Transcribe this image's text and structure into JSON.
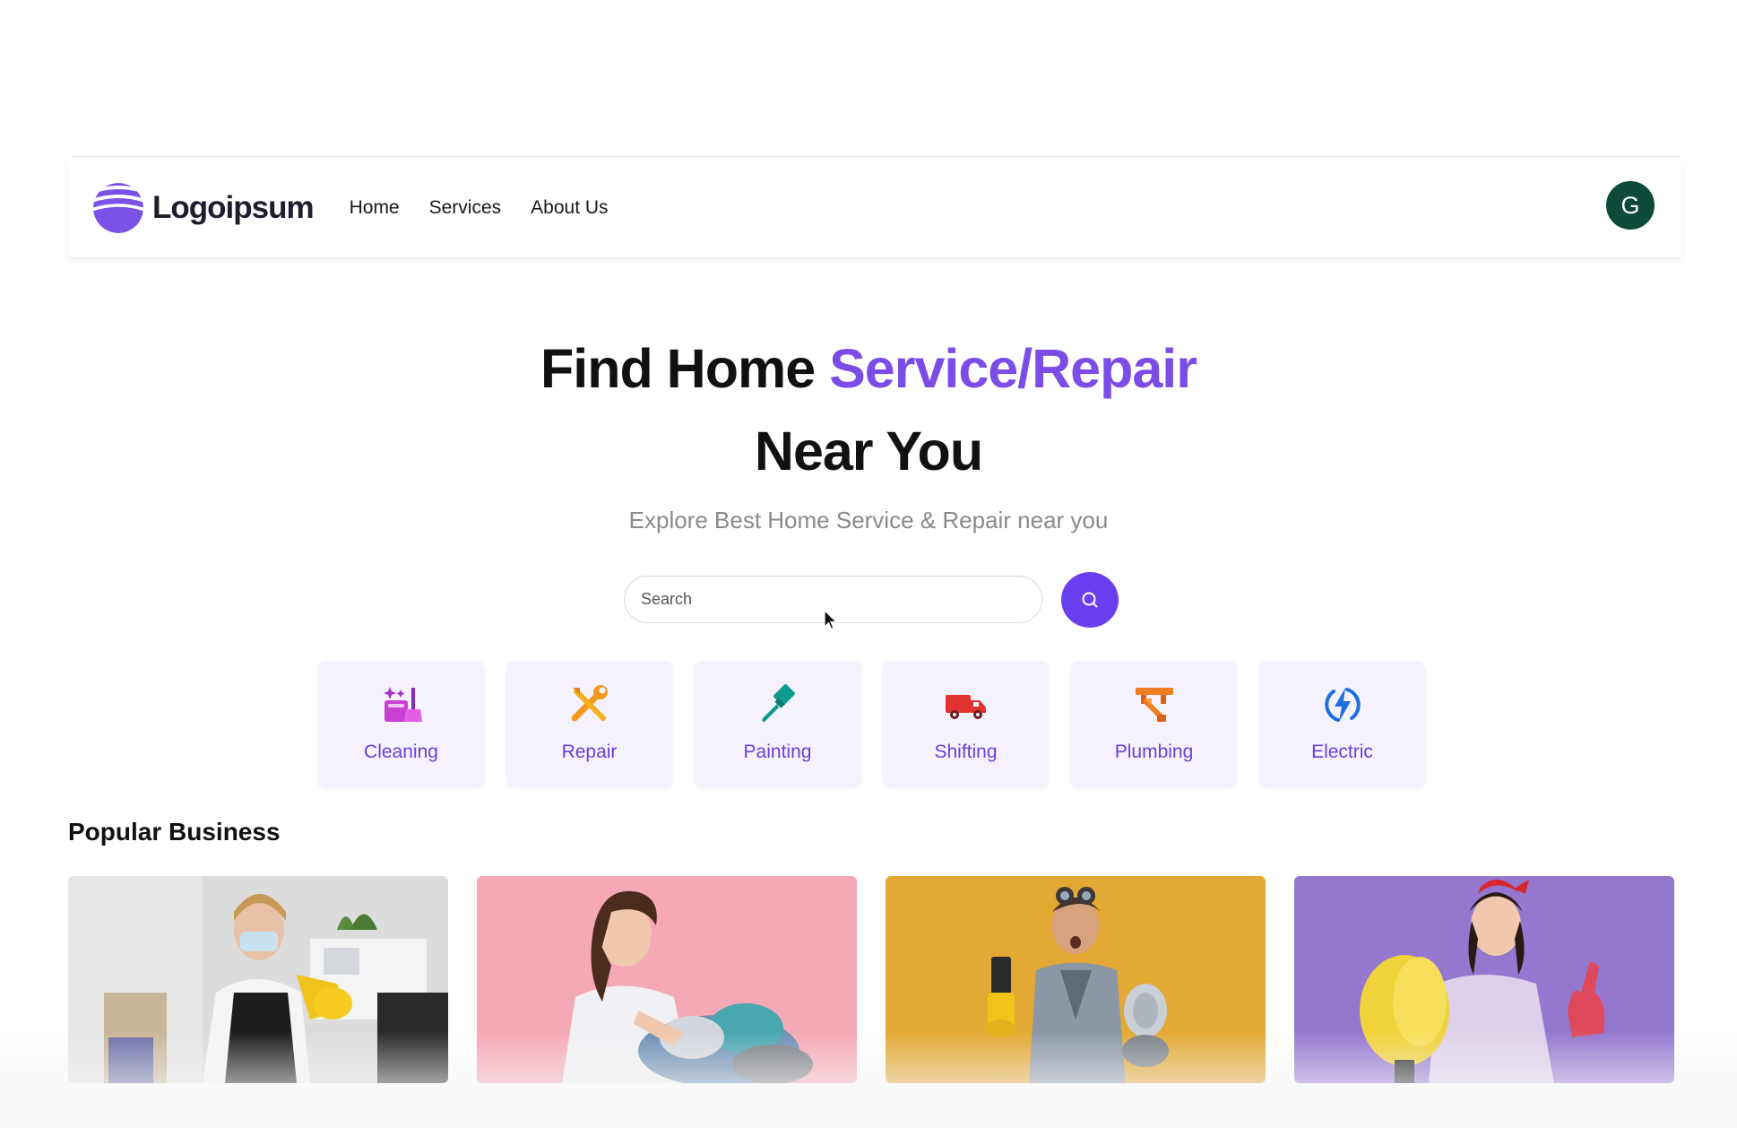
{
  "header": {
    "logo_text": "Logoipsum",
    "logo_icon": "logo-mark-icon",
    "nav": [
      {
        "label": "Home"
      },
      {
        "label": "Services"
      },
      {
        "label": "About Us"
      }
    ],
    "avatar_initial": "G",
    "avatar_color": "#0d4a3a"
  },
  "hero": {
    "title_part1": "Find Home ",
    "title_accent": "Service/Repair",
    "title_part2": "Near You",
    "subtitle": "Explore Best Home Service & Repair near you",
    "accent_color": "#7b4de6"
  },
  "search": {
    "placeholder": "Search",
    "button_icon": "search-icon",
    "button_color": "#6b3ff0"
  },
  "categories": [
    {
      "label": "Cleaning",
      "icon": "cleaning-icon"
    },
    {
      "label": "Repair",
      "icon": "repair-tools-icon"
    },
    {
      "label": "Painting",
      "icon": "paint-brush-icon"
    },
    {
      "label": "Shifting",
      "icon": "truck-icon"
    },
    {
      "label": "Plumbing",
      "icon": "plumbing-icon"
    },
    {
      "label": "Electric",
      "icon": "lightning-icon"
    }
  ],
  "popular": {
    "title": "Popular Business",
    "cards": [
      {
        "image": "cleaner-with-mask-thumbs-up",
        "bg": "#d9d9d9"
      },
      {
        "image": "woman-holding-laundry",
        "bg": "#f5a8b4"
      },
      {
        "image": "man-with-drill-and-goggles",
        "bg": "#e2a833"
      },
      {
        "image": "woman-painter-with-paint-roller",
        "bg": "#9478cf"
      }
    ]
  }
}
